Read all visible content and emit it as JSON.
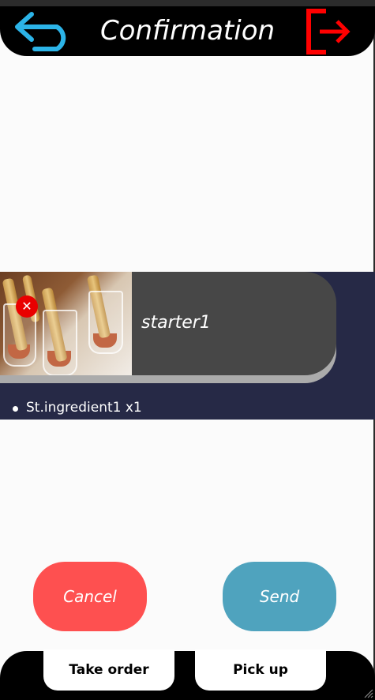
{
  "header": {
    "title": "Confirmation",
    "back_icon": "back-arrow-icon",
    "logout_icon": "logout-icon",
    "back_color": "#2cb4e8",
    "logout_color": "#ff0000"
  },
  "order": {
    "items": [
      {
        "name": "starter1",
        "photo": "starter-photo",
        "ingredients": [
          "St.ingredient1 x1"
        ]
      }
    ]
  },
  "actions": {
    "cancel_label": "Cancel",
    "send_label": "Send"
  },
  "footer": {
    "take_order_label": "Take order",
    "pick_up_label": "Pick up"
  },
  "colors": {
    "header_bg": "#000000",
    "band_bg": "#262946",
    "card_bg": "#474747",
    "cancel": "#fe5050",
    "send": "#4fa3be"
  }
}
